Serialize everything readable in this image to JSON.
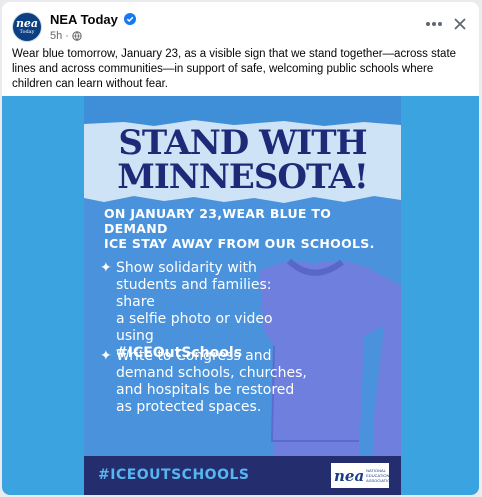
{
  "post": {
    "page_name": "NEA Today",
    "time": "5h",
    "visibility": "·",
    "caption": "Wear blue tomorrow, January 23, as a visible sign that we stand together—across state lines and across communities—in support of safe, welcoming public schools where children can learn without fear."
  },
  "avatar": {
    "line1": "nea",
    "line2": "Today"
  },
  "poster": {
    "headline_1": "STAND WITH",
    "headline_2": "MINNESOTA!",
    "subhead_1": "ON JANUARY 23,WEAR BLUE TO DEMAND",
    "subhead_2": "ICE STAY AWAY FROM OUR SCHOOLS.",
    "bullet_1_l1": "Show solidarity with",
    "bullet_1_l2": "students and families: share",
    "bullet_1_l3": "a selfie photo or video using",
    "bullet_1_tag": "#ICEOutSchools",
    "bullet_2_l1": "Write to Congress and",
    "bullet_2_l2": "demand schools, churches,",
    "bullet_2_l3": "and hospitals be restored",
    "bullet_2_l4": "as protected spaces.",
    "bottom_tag": "#ICEOUTSCHOOLS",
    "logo_word": "nea",
    "logo_sub": "NATIONAL EDUCATION ASSOCIATION"
  },
  "icons": {
    "verified": "verified-badge-icon",
    "globe": "globe-icon",
    "more": "more-options-icon",
    "close": "close-icon"
  },
  "colors": {
    "brand_blue": "#1877f2",
    "poster_bg": "#4a93dc",
    "headline": "#1e2a78",
    "bottom_bar": "#242d6d",
    "image_bg": "#3aa3e0"
  }
}
